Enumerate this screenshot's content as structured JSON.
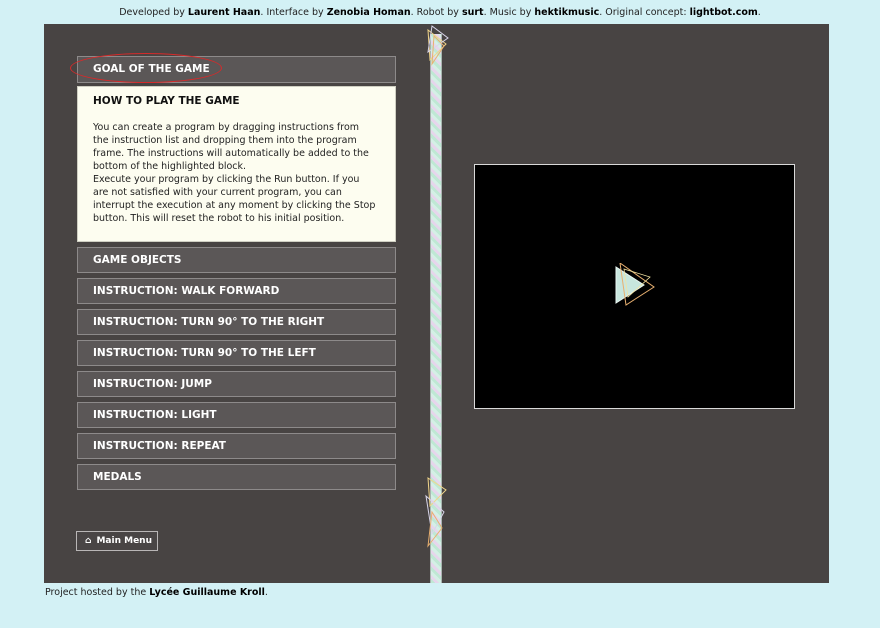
{
  "credits": {
    "developed_by": "Developed by",
    "developer": "Laurent Haan",
    "interface_by": ". Interface by",
    "interface_author": "Zenobia Homan",
    "robot_by": ". Robot by",
    "robot_author": "surt",
    "music_by": ". Music by",
    "music_author": "hektikmusic",
    "concept_label": ". Original concept:",
    "concept_site": "lightbot.com",
    "end": "."
  },
  "accordion": {
    "goal": "GOAL OF THE GAME",
    "how_to": {
      "title": "HOW TO PLAY THE GAME",
      "lines": [
        "You can create a program by dragging instructions from",
        "the instruction list and dropping them into the program",
        "frame. The instructions will automatically be added to the",
        "bottom of the highlighted block.",
        "Execute your program by clicking the Run button. If you",
        "are not satisfied with your current program, you can",
        "interrupt the execution at any moment by clicking the Stop",
        "button. This will reset the robot to his initial position."
      ]
    },
    "sections": [
      "GAME OBJECTS",
      "INSTRUCTION: WALK FORWARD",
      "INSTRUCTION: TURN 90° TO THE RIGHT",
      "INSTRUCTION: TURN 90° TO THE LEFT",
      "INSTRUCTION: JUMP",
      "INSTRUCTION: LIGHT",
      "INSTRUCTION: REPEAT",
      "MEDALS"
    ]
  },
  "main_menu": {
    "icon": "home-icon",
    "label": "Main Menu"
  },
  "footer": {
    "prefix": "Project hosted by the",
    "host": "Lycée Guillaume Kroll",
    "end": "."
  },
  "colors": {
    "background": "#d3f1f5",
    "panel": "#484443",
    "header": "#5b5757",
    "open_section": "#fdfdf0",
    "highlight": "#d62a2a"
  }
}
